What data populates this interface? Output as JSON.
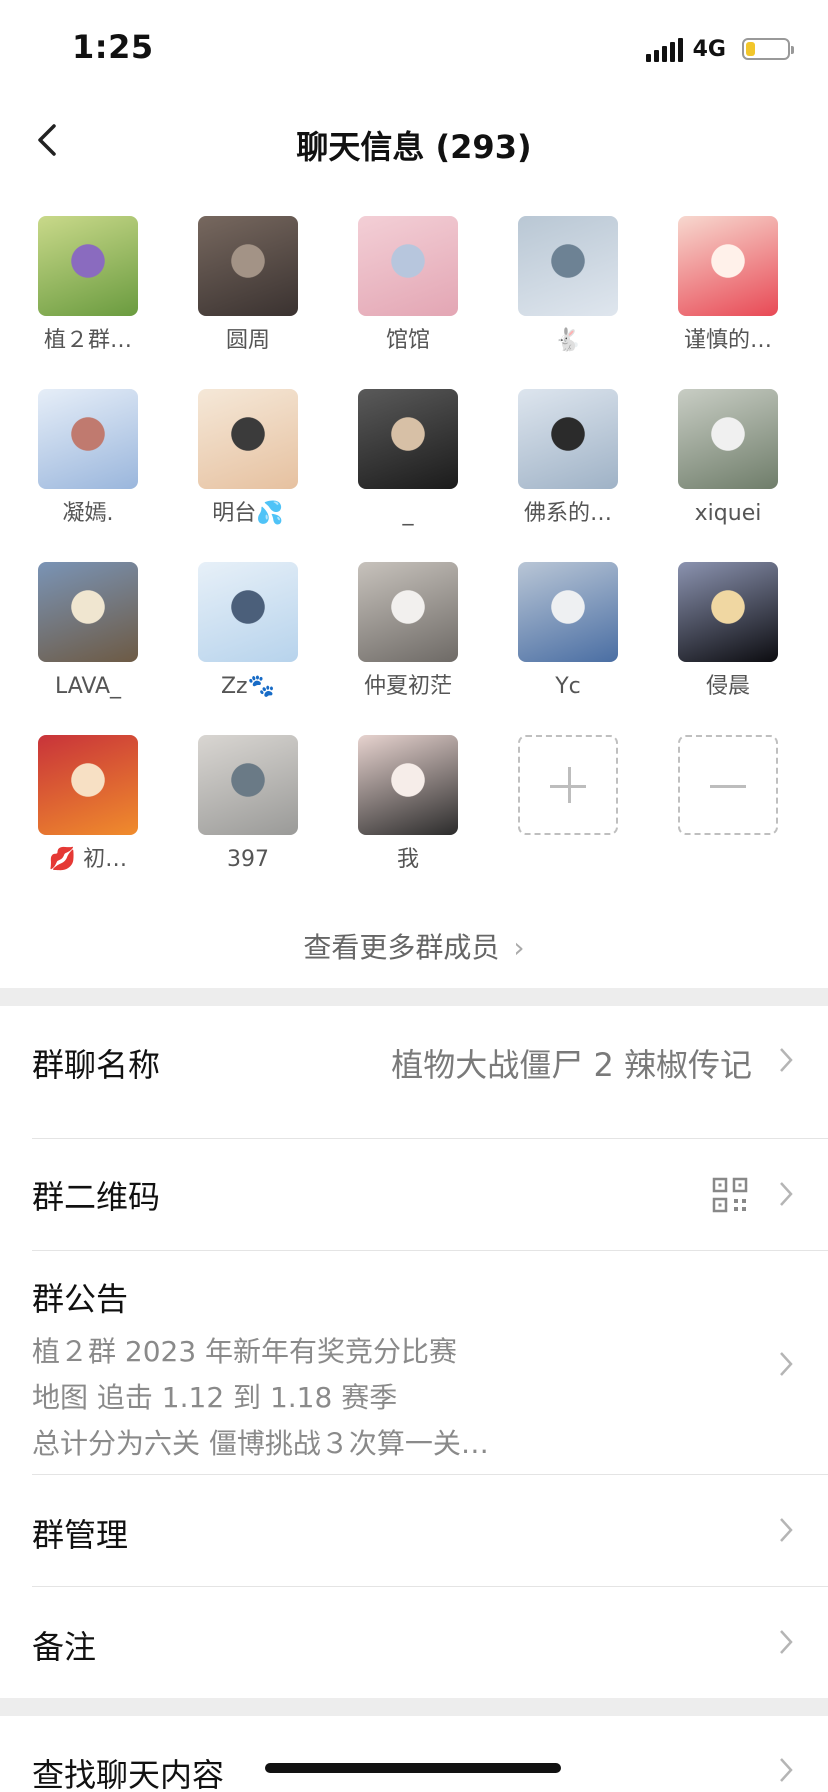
{
  "status": {
    "time": "1:25",
    "network": "4G",
    "battery_level": 0.22,
    "battery_color": "#f2c62b"
  },
  "nav": {
    "title": "聊天信息 (293)"
  },
  "members": [
    {
      "name": "植２群…",
      "colors": [
        "#6a9b3f",
        "#c9d98a",
        "#8a6bbf"
      ]
    },
    {
      "name": "圆周",
      "colors": [
        "#3a3230",
        "#77685f",
        "#a39386"
      ]
    },
    {
      "name": "馆馆",
      "colors": [
        "#e3a6b4",
        "#f3cfd6",
        "#b7c6dd"
      ]
    },
    {
      "name": "🐇",
      "colors": [
        "#dfe6ee",
        "#b9c7d4",
        "#6d8294"
      ]
    },
    {
      "name": "谨慎的…",
      "colors": [
        "#e84955",
        "#f7d8cf",
        "#fff1ea"
      ]
    },
    {
      "name": "凝嫣.",
      "colors": [
        "#9ab6dc",
        "#e6eef8",
        "#c07a6f"
      ]
    },
    {
      "name": "明台💦",
      "colors": [
        "#e6c1a0",
        "#f5e8d8",
        "#3b3b3b"
      ]
    },
    {
      "name": "_",
      "colors": [
        "#1b1b1b",
        "#5a5a5a",
        "#d7c0a6"
      ]
    },
    {
      "name": "佛系的…",
      "colors": [
        "#9fb2c6",
        "#dde5ee",
        "#2b2b2b"
      ]
    },
    {
      "name": "xiquei",
      "colors": [
        "#6f7d6a",
        "#c8cdc4",
        "#f0f0f0"
      ]
    },
    {
      "name": "LAVA_",
      "colors": [
        "#6d5a44",
        "#7a94b6",
        "#f0e6d0"
      ]
    },
    {
      "name": "Zz🐾",
      "colors": [
        "#b7d3ec",
        "#e7f0f8",
        "#4b5f7a"
      ]
    },
    {
      "name": "仲夏初茫",
      "colors": [
        "#6e6a66",
        "#c7c2bc",
        "#f2f0ee"
      ]
    },
    {
      "name": "Yc",
      "colors": [
        "#4a6ea3",
        "#b9c6d6",
        "#eef0f2"
      ]
    },
    {
      "name": "侵晨",
      "colors": [
        "#0c0c10",
        "#8b93b0",
        "#f0d7a2"
      ]
    },
    {
      "name": "💋 初…",
      "colors": [
        "#f08c2c",
        "#c8333a",
        "#f7e0c4"
      ]
    },
    {
      "name": "397",
      "colors": [
        "#9a9a98",
        "#d9d6d2",
        "#6a7a86"
      ]
    },
    {
      "name": "我",
      "colors": [
        "#2b2b2b",
        "#e7d3cf",
        "#f6ede9"
      ]
    }
  ],
  "actions": {
    "add": "+",
    "remove": "−"
  },
  "more_members": "查看更多群成员",
  "settings": {
    "group_name_label": "群聊名称",
    "group_name_value": "植物大战僵尸 2 辣椒传记",
    "qr_label": "群二维码",
    "notice_label": "群公告",
    "notice_lines": [
      "植２群 2023 年新年有奖竞分比赛",
      "地图 追击 1.12 到 1.18 赛季",
      "总计分为六关 僵博挑战３次算一关…"
    ],
    "manage_label": "群管理",
    "remark_label": "备注",
    "search_label": "查找聊天内容"
  }
}
